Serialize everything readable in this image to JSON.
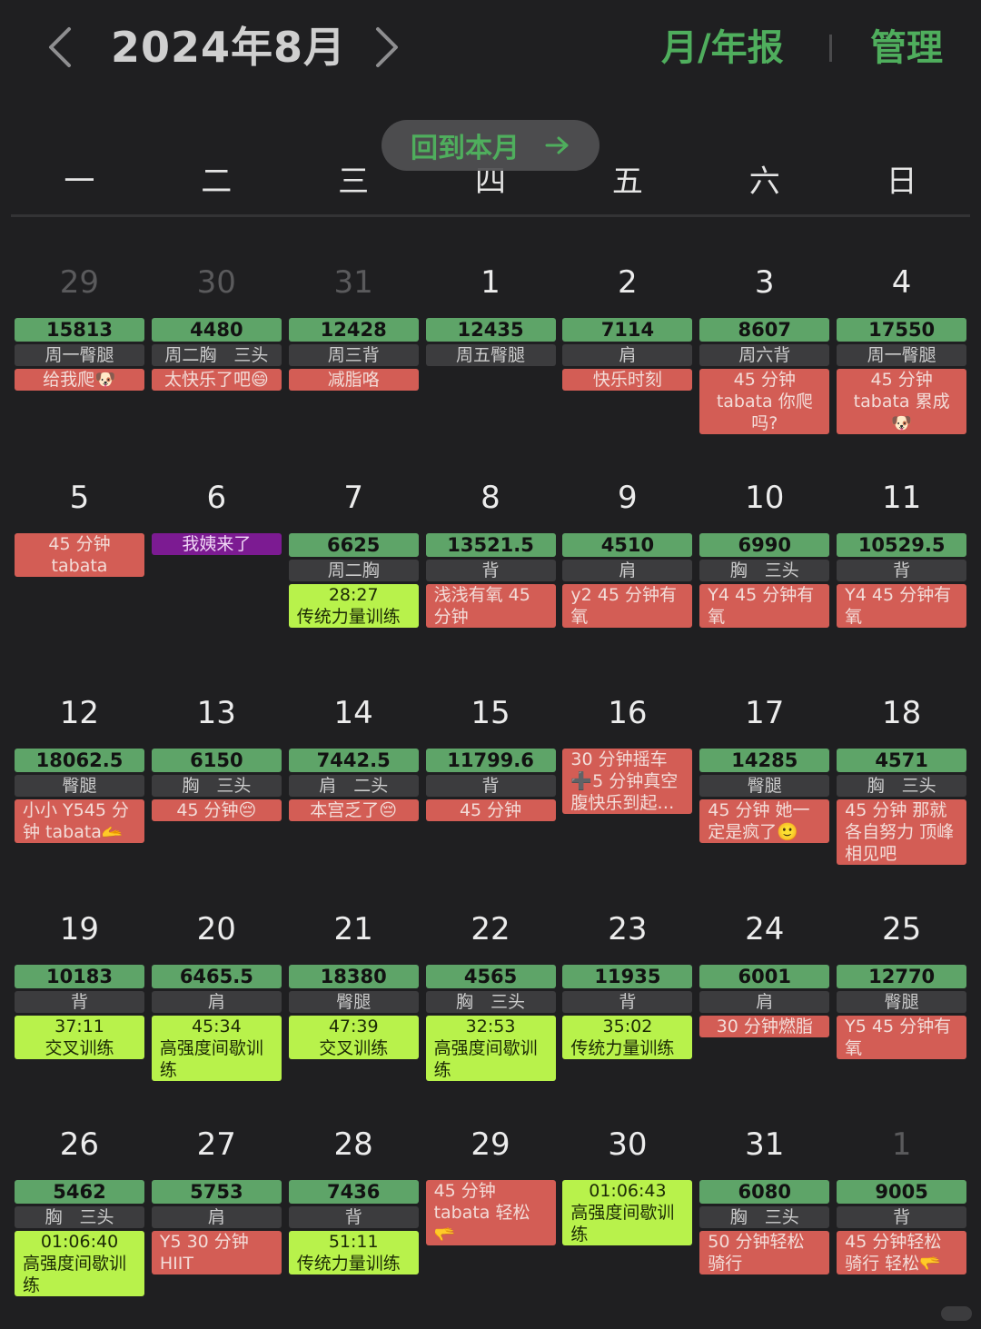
{
  "header": {
    "title": "2024年8月",
    "report_label": "月/年报",
    "manage_label": "管理"
  },
  "back_to_month": "回到本月",
  "weekdays": [
    "一",
    "二",
    "三",
    "四",
    "五",
    "六",
    "日"
  ],
  "colors": {
    "background": "#1f1f21",
    "accent_green": "#4fae5d",
    "steps_bar": "#5ea468",
    "note_red": "#d35d55",
    "timer_lime": "#b8f24b",
    "period_purple": "#7c1b92",
    "tag_gray": "#3c3c3e"
  },
  "weeks": [
    [
      {
        "day": "29",
        "muted": true,
        "steps": "15813",
        "tag": "周一臀腿",
        "notes": [
          {
            "type": "note",
            "text": "给我爬🐶",
            "center": true
          }
        ]
      },
      {
        "day": "30",
        "muted": true,
        "steps": "4480",
        "tag": "周二胸　三头",
        "notes": [
          {
            "type": "note",
            "text": "太快乐了吧😄",
            "center": true
          }
        ]
      },
      {
        "day": "31",
        "muted": true,
        "steps": "12428",
        "tag": "周三背",
        "notes": [
          {
            "type": "note",
            "text": "减脂咯",
            "center": true
          }
        ]
      },
      {
        "day": "1",
        "steps": "12435",
        "tag": "周五臀腿",
        "notes": []
      },
      {
        "day": "2",
        "steps": "7114",
        "tag": "肩",
        "notes": [
          {
            "type": "note",
            "text": "快乐时刻",
            "center": true
          }
        ]
      },
      {
        "day": "3",
        "steps": "8607",
        "tag": "周六背",
        "notes": [
          {
            "type": "note",
            "text": "45 分钟 tabata 你爬吗?",
            "center": true
          }
        ]
      },
      {
        "day": "4",
        "steps": "17550",
        "tag": "周一臀腿",
        "notes": [
          {
            "type": "note",
            "text": "45 分钟 tabata 累成🐶",
            "center": true
          }
        ]
      }
    ],
    [
      {
        "day": "5",
        "notes": [
          {
            "type": "note",
            "text": "45 分钟 tabata",
            "center": true
          }
        ]
      },
      {
        "day": "6",
        "notes": [
          {
            "type": "purple",
            "text": "我姨来了"
          }
        ]
      },
      {
        "day": "7",
        "steps": "6625",
        "tag": "周二胸",
        "notes": [
          {
            "type": "lime",
            "time": "28:27",
            "text": "传统力量训练"
          }
        ]
      },
      {
        "day": "8",
        "steps": "13521.5",
        "tag": "背",
        "notes": [
          {
            "type": "note",
            "text": "浅浅有氧 45 分钟"
          }
        ]
      },
      {
        "day": "9",
        "steps": "4510",
        "tag": "肩",
        "notes": [
          {
            "type": "note",
            "text": "y2 45 分钟有氧"
          }
        ]
      },
      {
        "day": "10",
        "steps": "6990",
        "tag": "胸　三头",
        "notes": [
          {
            "type": "note",
            "text": "Y4 45 分钟有氧"
          }
        ]
      },
      {
        "day": "11",
        "steps": "10529.5",
        "tag": "背",
        "notes": [
          {
            "type": "note",
            "text": "Y4 45 分钟有氧"
          }
        ]
      }
    ],
    [
      {
        "day": "12",
        "steps": "18062.5",
        "tag": "臀腿",
        "notes": [
          {
            "type": "note",
            "text": "小小 Y545 分钟 tabata🫴"
          }
        ]
      },
      {
        "day": "13",
        "steps": "6150",
        "tag": "胸　三头",
        "notes": [
          {
            "type": "note",
            "text": "45 分钟😔",
            "center": true
          }
        ]
      },
      {
        "day": "14",
        "steps": "7442.5",
        "tag": "肩　二头",
        "notes": [
          {
            "type": "note",
            "text": "本宫乏了😔",
            "center": true
          }
        ]
      },
      {
        "day": "15",
        "steps": "11799.6",
        "tag": "背",
        "notes": [
          {
            "type": "note",
            "text": "45 分钟",
            "center": true
          }
        ]
      },
      {
        "day": "16",
        "notes": [
          {
            "type": "note",
            "text": "30 分钟摇车➕5 分钟真空腹快乐到起…"
          }
        ]
      },
      {
        "day": "17",
        "steps": "14285",
        "tag": "臀腿",
        "notes": [
          {
            "type": "note",
            "text": "45 分钟 她一定是疯了🙂"
          }
        ]
      },
      {
        "day": "18",
        "steps": "4571",
        "tag": "胸　三头",
        "notes": [
          {
            "type": "note",
            "text": "45 分钟 那就各自努力 顶峰相见吧"
          }
        ]
      }
    ],
    [
      {
        "day": "19",
        "steps": "10183",
        "tag": "背",
        "notes": [
          {
            "type": "lime",
            "time": "37:11",
            "text": "交叉训练",
            "center": true
          }
        ]
      },
      {
        "day": "20",
        "steps": "6465.5",
        "tag": "肩",
        "notes": [
          {
            "type": "lime",
            "time": "45:34",
            "text": "高强度间歇训练"
          }
        ]
      },
      {
        "day": "21",
        "steps": "18380",
        "tag": "臀腿",
        "notes": [
          {
            "type": "lime",
            "time": "47:39",
            "text": "交叉训练",
            "center": true
          }
        ]
      },
      {
        "day": "22",
        "steps": "4565",
        "tag": "胸　三头",
        "notes": [
          {
            "type": "lime",
            "time": "32:53",
            "text": "高强度间歇训练"
          }
        ]
      },
      {
        "day": "23",
        "steps": "11935",
        "tag": "背",
        "notes": [
          {
            "type": "lime",
            "time": "35:02",
            "text": "传统力量训练"
          }
        ]
      },
      {
        "day": "24",
        "steps": "6001",
        "tag": "肩",
        "notes": [
          {
            "type": "note",
            "text": "30 分钟燃脂",
            "center": true
          }
        ]
      },
      {
        "day": "25",
        "steps": "12770",
        "tag": "臀腿",
        "notes": [
          {
            "type": "note",
            "text": "Y5 45 分钟有氧"
          }
        ]
      }
    ],
    [
      {
        "day": "26",
        "steps": "5462",
        "tag": "胸　三头",
        "notes": [
          {
            "type": "lime",
            "time": "01:06:40",
            "text": "高强度间歇训练"
          }
        ]
      },
      {
        "day": "27",
        "steps": "5753",
        "tag": "肩",
        "notes": [
          {
            "type": "note",
            "text": "Y5 30 分钟 HIIT"
          }
        ]
      },
      {
        "day": "28",
        "steps": "7436",
        "tag": "背",
        "notes": [
          {
            "type": "lime",
            "time": "51:11",
            "text": "传统力量训练"
          }
        ]
      },
      {
        "day": "29",
        "notes": [
          {
            "type": "note",
            "text": "45 分钟 tabata 轻松🫳"
          }
        ]
      },
      {
        "day": "30",
        "notes": [
          {
            "type": "lime",
            "time": "01:06:43",
            "text": "高强度间歇训练"
          }
        ]
      },
      {
        "day": "31",
        "steps": "6080",
        "tag": "胸　三头",
        "notes": [
          {
            "type": "note",
            "text": "50 分钟轻松骑行"
          }
        ]
      },
      {
        "day": "1",
        "muted": true,
        "steps": "9005",
        "tag": "背",
        "notes": [
          {
            "type": "note",
            "text": "45 分钟轻松骑行 轻松🫳"
          }
        ]
      }
    ]
  ]
}
